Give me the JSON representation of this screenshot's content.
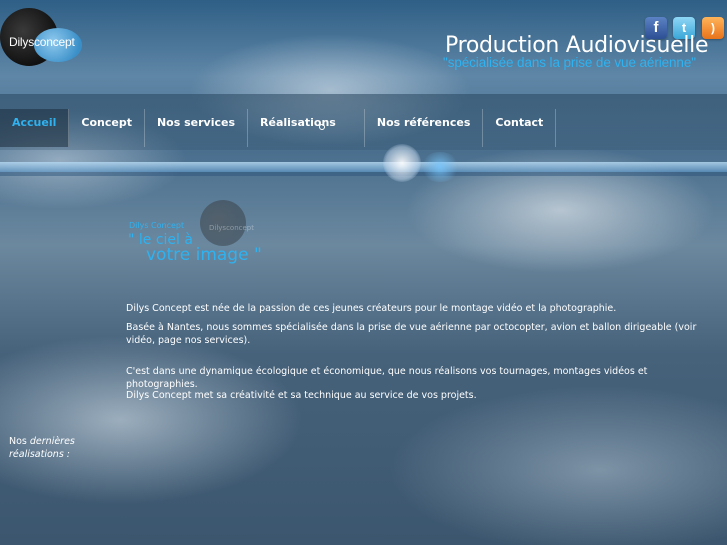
{
  "logo": {
    "part1": "Dilys",
    "part2": "concept"
  },
  "social": [
    {
      "name": "facebook-icon",
      "glyph": "f"
    },
    {
      "name": "twitter-icon",
      "glyph": "t"
    },
    {
      "name": "rss-icon",
      "glyph": ")"
    }
  ],
  "header": {
    "title": "Production Audiovisuelle",
    "tagline": "\"spécialisée dans la prise de vue aérienne\""
  },
  "nav": [
    {
      "label": "Accueil",
      "active": true
    },
    {
      "label": "Concept"
    },
    {
      "label": "Nos services"
    },
    {
      "label": "Réalisations"
    },
    {
      "label": "Nos références"
    },
    {
      "label": "Contact"
    }
  ],
  "promo": {
    "brand": "Dilys Concept",
    "brand_watermark": "Dilysconcept",
    "line1": "\" le ciel à",
    "line2": "votre image \""
  },
  "content": {
    "p1": "Dilys Concept est née de la passion de ces jeunes créateurs pour le montage vidéo et la photographie.",
    "p2": "Basée à Nantes, nous sommes spécialisée dans la prise de vue  aérienne par octocopter, avion et ballon dirigeable (voir vidéo, page nos services).",
    "p3": "C'est dans une dynamique écologique et économique, que nous réalisons vos tournages, montages vidéos et photographies.",
    "p4": "Dilys Concept met sa  créativité et sa technique au service de vos projets."
  },
  "sidebar": {
    "line1_prefix": "Nos ",
    "line1_em": "dernières",
    "line2_em": "réalisations :"
  },
  "colors": {
    "accent": "#2fb2ef",
    "text": "#ffffff"
  }
}
